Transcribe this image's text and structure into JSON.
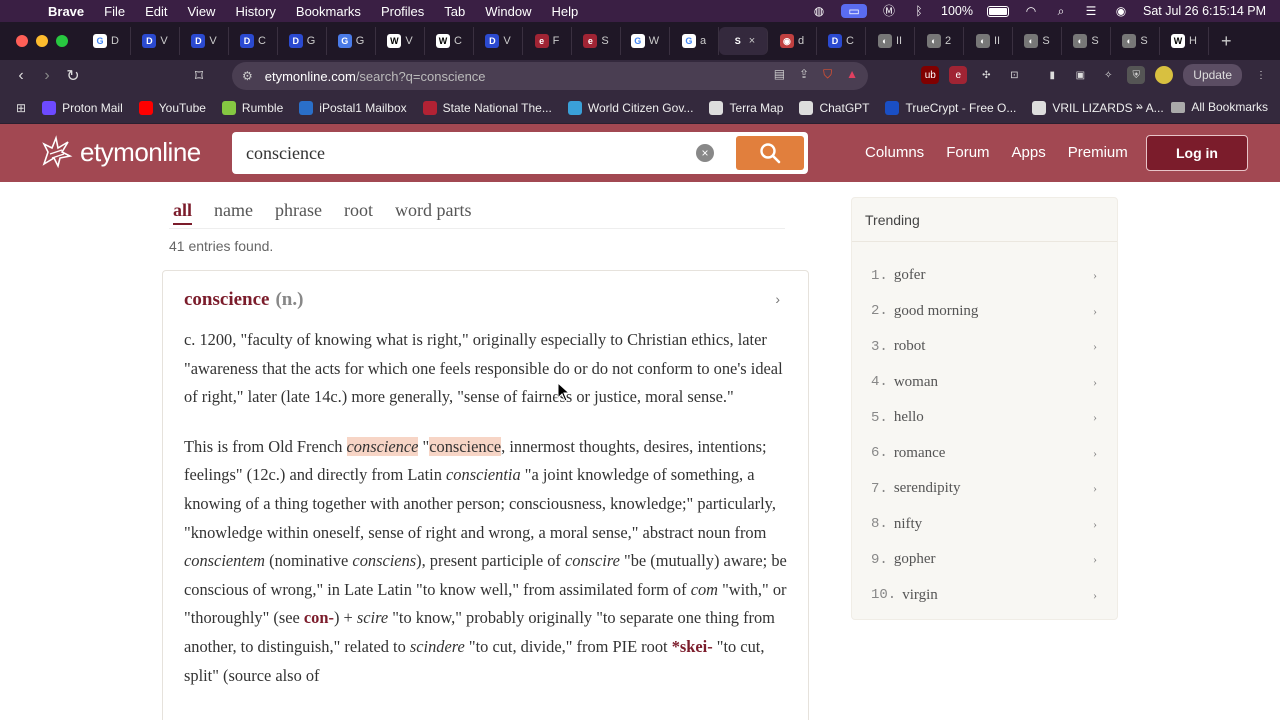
{
  "menubar": {
    "app": "Brave",
    "items": [
      "File",
      "Edit",
      "View",
      "History",
      "Bookmarks",
      "Profiles",
      "Tab",
      "Window",
      "Help"
    ],
    "battery": "100%",
    "datetime": "Sat Jul 26  6:15:14 PM"
  },
  "tabs": [
    {
      "fav": "G",
      "label": "D",
      "color": "#ffffff",
      "fg": "#4285f4"
    },
    {
      "fav": "D",
      "label": "V",
      "color": "#2b4ad0",
      "fg": "#ffffff"
    },
    {
      "fav": "D",
      "label": "V",
      "color": "#2b4ad0",
      "fg": "#ffffff"
    },
    {
      "fav": "D",
      "label": "C",
      "color": "#2b4ad0",
      "fg": "#ffffff"
    },
    {
      "fav": "D",
      "label": "G",
      "color": "#2b4ad0",
      "fg": "#ffffff"
    },
    {
      "fav": "G",
      "label": "G",
      "color": "#4a7be8",
      "fg": "#ffffff"
    },
    {
      "fav": "W",
      "label": "V",
      "color": "#ffffff",
      "fg": "#000000"
    },
    {
      "fav": "W",
      "label": "C",
      "color": "#ffffff",
      "fg": "#000000"
    },
    {
      "fav": "D",
      "label": "V",
      "color": "#2b4ad0",
      "fg": "#ffffff"
    },
    {
      "fav": "e",
      "label": "F",
      "color": "#a02434",
      "fg": "#ffffff"
    },
    {
      "fav": "e",
      "label": "S",
      "color": "#a02434",
      "fg": "#ffffff"
    },
    {
      "fav": "G",
      "label": "W",
      "color": "#ffffff",
      "fg": "#4285f4"
    },
    {
      "fav": "G",
      "label": "a",
      "color": "#ffffff",
      "fg": "#4285f4"
    },
    {
      "fav": "S",
      "label": "×",
      "color": "#34293d",
      "fg": "#ffffff",
      "active": true
    },
    {
      "fav": "◉",
      "label": "d",
      "color": "#c04040",
      "fg": "#ffffff"
    },
    {
      "fav": "D",
      "label": "C",
      "color": "#2b4ad0",
      "fg": "#ffffff"
    },
    {
      "fav": "◐",
      "label": "II",
      "color": "#777777",
      "fg": "#ffffff"
    },
    {
      "fav": "◐",
      "label": "2",
      "color": "#777777",
      "fg": "#ffffff"
    },
    {
      "fav": "◐",
      "label": "II",
      "color": "#777777",
      "fg": "#ffffff"
    },
    {
      "fav": "◐",
      "label": "S",
      "color": "#777777",
      "fg": "#ffffff"
    },
    {
      "fav": "◐",
      "label": "S",
      "color": "#777777",
      "fg": "#ffffff"
    },
    {
      "fav": "◐",
      "label": "S",
      "color": "#777777",
      "fg": "#ffffff"
    },
    {
      "fav": "W",
      "label": "H",
      "color": "#ffffff",
      "fg": "#000000"
    }
  ],
  "address": {
    "host": "etymonline.com",
    "path": "/search?q=conscience"
  },
  "toolbar": {
    "update": "Update"
  },
  "bookmarks": [
    {
      "label": "Proton Mail",
      "color": "#6d4aff"
    },
    {
      "label": "YouTube",
      "color": "#ff0000"
    },
    {
      "label": "Rumble",
      "color": "#85c742"
    },
    {
      "label": "iPostal1 Mailbox",
      "color": "#2a6fc9"
    },
    {
      "label": "State National The...",
      "color": "#b22234"
    },
    {
      "label": "World Citizen Gov...",
      "color": "#3aa0d8"
    },
    {
      "label": "Terra Map",
      "color": "#dddddd"
    },
    {
      "label": "ChatGPT",
      "color": "#dddddd"
    },
    {
      "label": "TrueCrypt - Free O...",
      "color": "#1a4fc4"
    },
    {
      "label": "VRIL LIZARDS ~ A...",
      "color": "#dddddd"
    }
  ],
  "all_bookmarks": "All Bookmarks",
  "site": {
    "logo": "etymonline",
    "search_value": "conscience",
    "nav": [
      "Columns",
      "Forum",
      "Apps",
      "Premium"
    ],
    "login": "Log in"
  },
  "result_tabs": [
    "all",
    "name",
    "phrase",
    "root",
    "word parts"
  ],
  "entries_found": "41 entries found.",
  "entry": {
    "word": "conscience",
    "pos": "(n.)"
  },
  "trending": {
    "title": "Trending",
    "items": [
      {
        "rank": "1.",
        "word": "gofer"
      },
      {
        "rank": "2.",
        "word": "good morning"
      },
      {
        "rank": "3.",
        "word": "robot"
      },
      {
        "rank": "4.",
        "word": "woman"
      },
      {
        "rank": "5.",
        "word": "hello"
      },
      {
        "rank": "6.",
        "word": "romance"
      },
      {
        "rank": "7.",
        "word": "serendipity"
      },
      {
        "rank": "8.",
        "word": "nifty"
      },
      {
        "rank": "9.",
        "word": "gopher"
      },
      {
        "rank": "10.",
        "word": "virgin"
      }
    ]
  }
}
